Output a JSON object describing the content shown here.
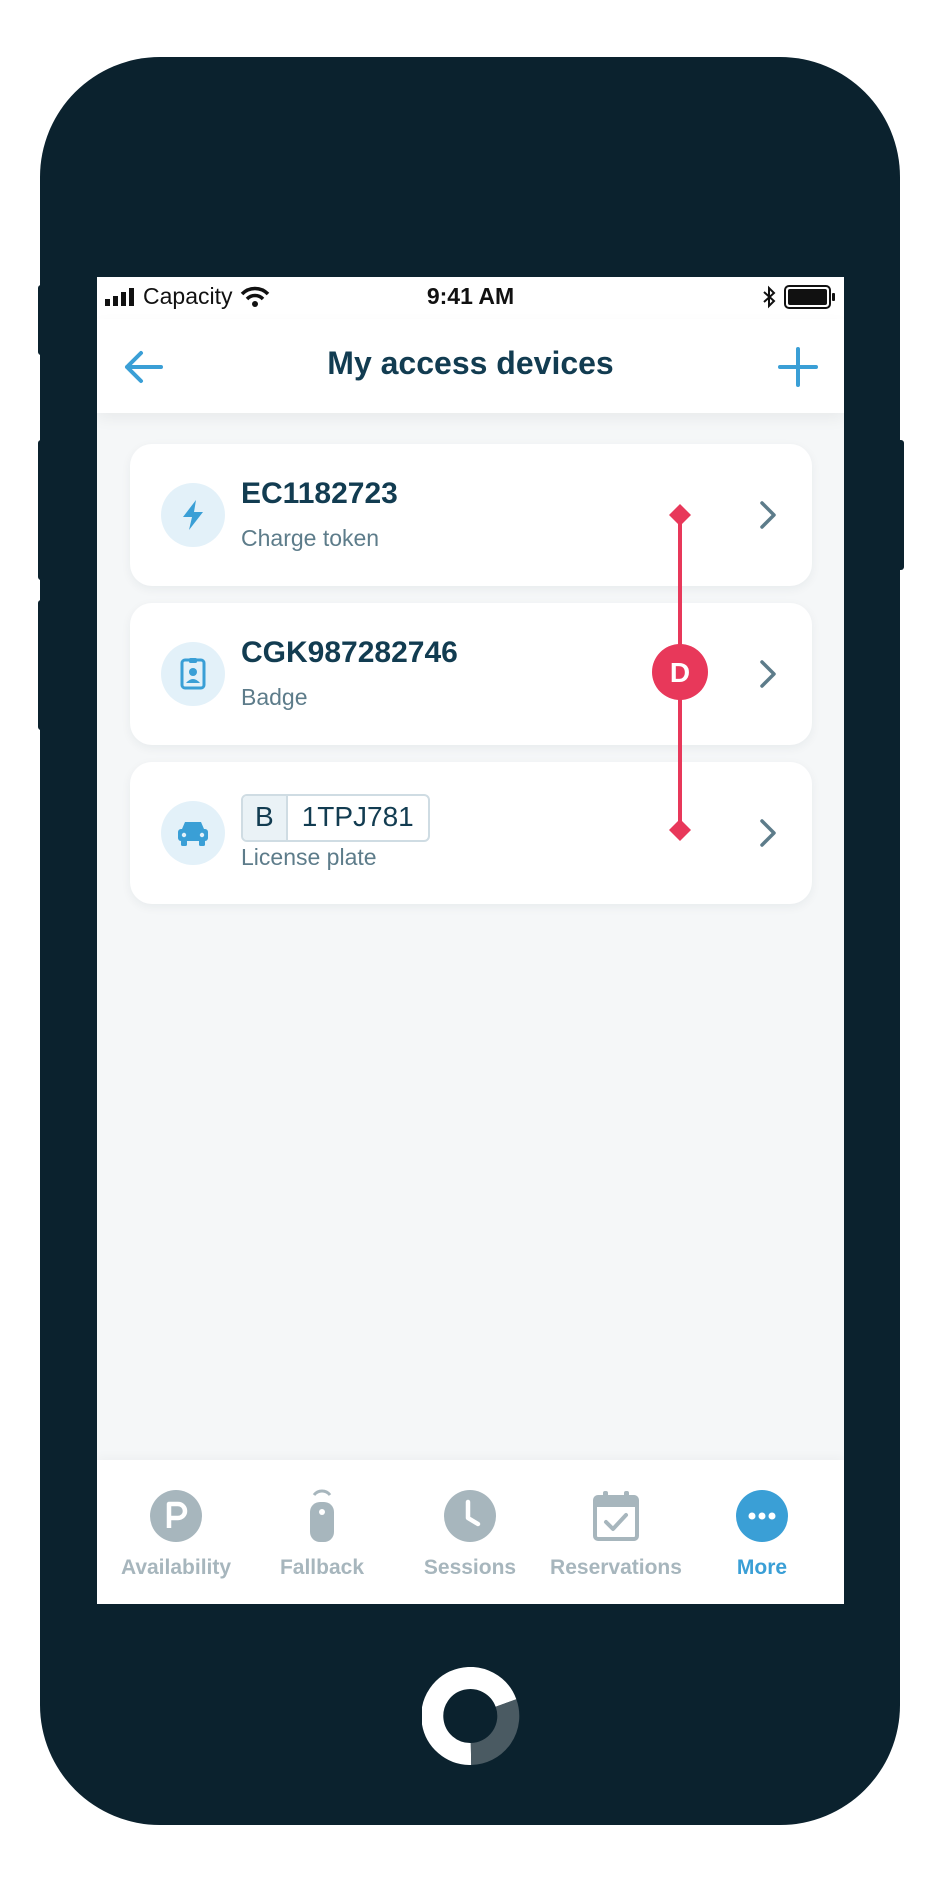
{
  "status_bar": {
    "carrier": "Capacity",
    "time": "9:41 AM"
  },
  "nav": {
    "title": "My access devices",
    "back_icon": "arrow-left-icon",
    "add_icon": "plus-icon"
  },
  "devices": [
    {
      "title": "EC1182723",
      "subtitle": "Charge token",
      "icon": "lightning-icon"
    },
    {
      "title": "CGK987282746",
      "subtitle": "Badge",
      "icon": "badge-icon"
    },
    {
      "plate_country": "B",
      "plate_number": "1TPJ781",
      "subtitle": "License plate",
      "icon": "car-icon"
    }
  ],
  "annotation": {
    "label": "D",
    "color": "#e8385a"
  },
  "tabs": [
    {
      "label": "Availability",
      "icon": "parking-icon",
      "active": false
    },
    {
      "label": "Fallback",
      "icon": "remote-icon",
      "active": false
    },
    {
      "label": "Sessions",
      "icon": "clock-icon",
      "active": false
    },
    {
      "label": "Reservations",
      "icon": "calendar-check-icon",
      "active": false
    },
    {
      "label": "More",
      "icon": "more-icon",
      "active": true
    }
  ],
  "colors": {
    "primary": "#123c51",
    "accent": "#3a9fd6",
    "inactive": "#a7b6bd",
    "device_frame": "#0b222e"
  }
}
